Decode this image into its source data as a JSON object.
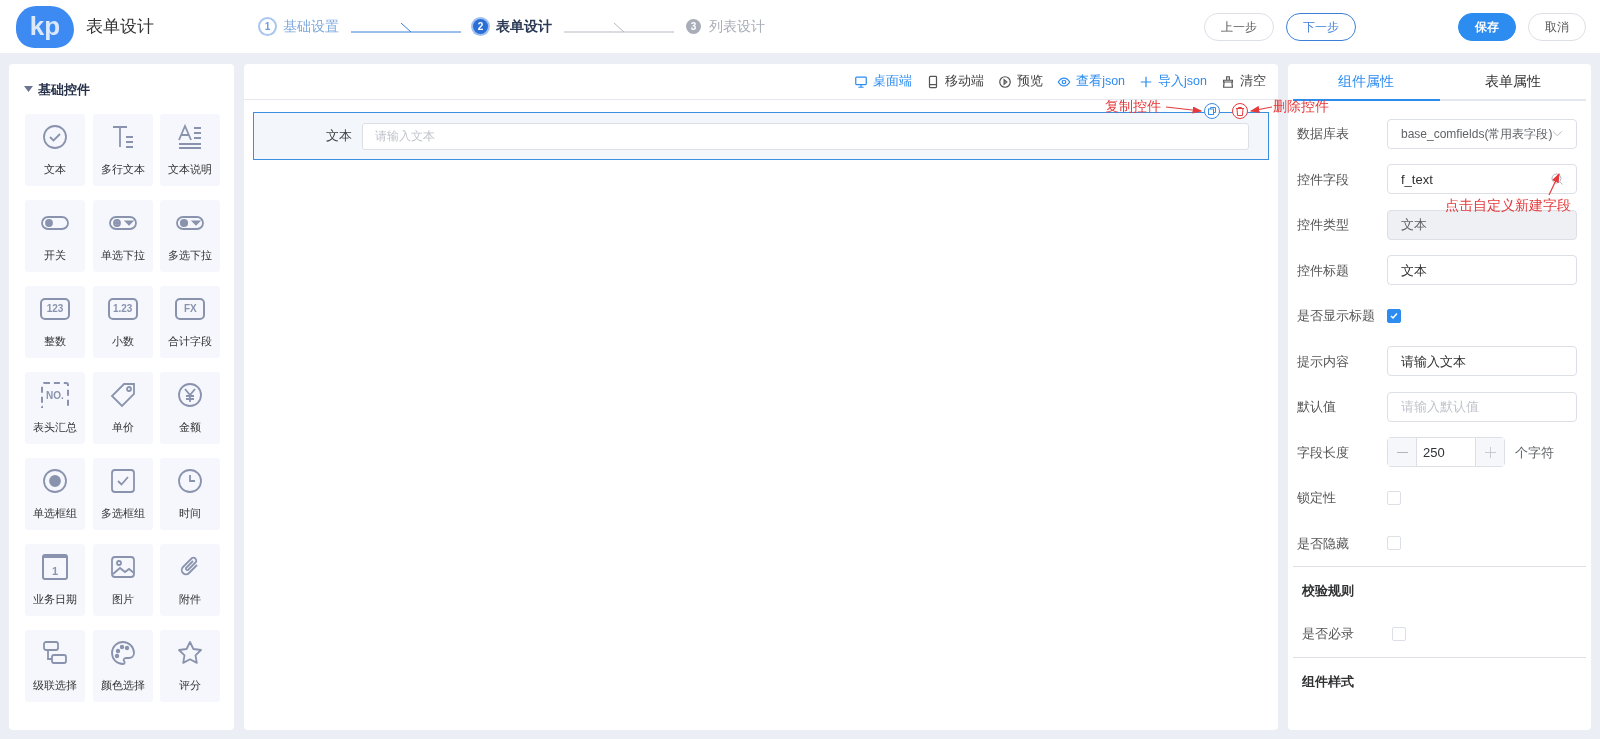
{
  "header": {
    "logo_text": "kp",
    "title": "表单设计",
    "steps": [
      {
        "number": "1",
        "label": "基础设置",
        "completed": true,
        "selected": false
      },
      {
        "number": "2",
        "label": "表单设计",
        "completed": false,
        "selected": true
      },
      {
        "number": "3",
        "label": "列表设计",
        "completed": false,
        "selected": false
      }
    ],
    "buttons": [
      {
        "label": "上一步",
        "kind": "plain"
      },
      {
        "label": "下一步",
        "kind": "outline"
      },
      {
        "label": "保存",
        "kind": "primary"
      },
      {
        "label": "取消",
        "kind": "plain"
      }
    ]
  },
  "palette": {
    "title": "基础控件",
    "expanded": true,
    "controls": [
      {
        "label": "文本"
      },
      {
        "label": "多行文本"
      },
      {
        "label": "文本说明"
      },
      {
        "label": "开关"
      },
      {
        "label": "单选下拉"
      },
      {
        "label": "多选下拉"
      },
      {
        "label": "整数",
        "icon_text": "123"
      },
      {
        "label": "小数",
        "icon_text": "1.23"
      },
      {
        "label": "合计字段",
        "icon_text": "FX"
      },
      {
        "label": "表头汇总",
        "icon_text": "NO."
      },
      {
        "label": "单价"
      },
      {
        "label": "金额"
      },
      {
        "label": "单选框组"
      },
      {
        "label": "多选框组"
      },
      {
        "label": "时间"
      },
      {
        "label": "业务日期",
        "icon_text": "1"
      },
      {
        "label": "图片"
      },
      {
        "label": "附件"
      },
      {
        "label": "级联选择"
      },
      {
        "label": "颜色选择"
      },
      {
        "label": "评分"
      }
    ]
  },
  "canvas": {
    "toolbar": [
      {
        "label": "桌面端",
        "kind": "device",
        "selected": true
      },
      {
        "label": "移动端",
        "kind": "device",
        "selected": false
      },
      {
        "label": "预览",
        "kind": "action"
      },
      {
        "label": "查看json",
        "kind": "link"
      },
      {
        "label": "导入json",
        "kind": "link"
      },
      {
        "label": "清空",
        "kind": "action"
      }
    ],
    "fields": [
      {
        "label": "文本",
        "placeholder": "请输入文本",
        "selected": true
      }
    ]
  },
  "annotations": [
    {
      "text": "复制控件"
    },
    {
      "text": "删除控件"
    },
    {
      "text": "点击自定义新建字段"
    }
  ],
  "properties": {
    "tabs": [
      {
        "label": "组件属性",
        "selected": true
      },
      {
        "label": "表单属性",
        "selected": false
      }
    ],
    "sections": [
      {
        "rows": [
          {
            "label": "数据库表",
            "kind": "select",
            "value": "base_comfields(常用表字段)"
          },
          {
            "label": "控件字段",
            "kind": "search",
            "value": "f_text"
          },
          {
            "label": "控件类型",
            "kind": "readonly",
            "value": "文本"
          },
          {
            "label": "控件标题",
            "kind": "text",
            "value": "文本"
          },
          {
            "label": "是否显示标题",
            "kind": "checkbox",
            "checked": true
          },
          {
            "label": "提示内容",
            "kind": "text",
            "value": "请输入文本"
          },
          {
            "label": "默认值",
            "kind": "text",
            "placeholder": "请输入默认值"
          },
          {
            "label": "字段长度",
            "kind": "stepper",
            "value": "250",
            "unit": "个字符"
          },
          {
            "label": "锁定性",
            "kind": "checkbox",
            "checked": false
          },
          {
            "label": "是否隐藏",
            "kind": "checkbox",
            "checked": false
          }
        ]
      },
      {
        "title": "校验规则",
        "rows": [
          {
            "label": "是否必录",
            "kind": "checkbox",
            "checked": false
          }
        ]
      },
      {
        "title": "组件样式"
      }
    ]
  }
}
